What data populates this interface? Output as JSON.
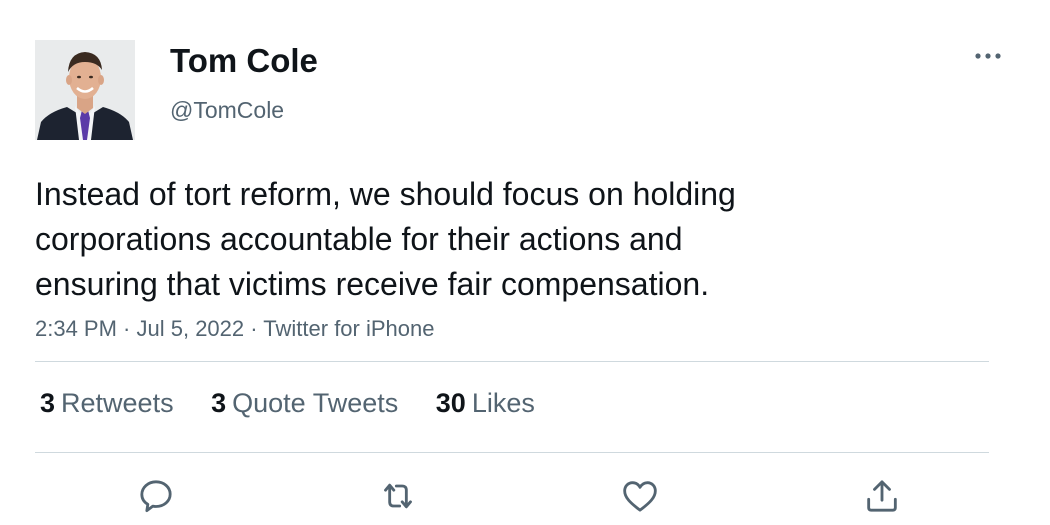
{
  "author": {
    "name": "Tom Cole",
    "handle": "@TomCole"
  },
  "more_icon": "more-horizontal-icon",
  "tweet": {
    "text": "Instead of tort reform, we should focus on holding\ncorporations accountable for their actions and\nensuring that victims receive fair compensation.",
    "time": "2:34 PM",
    "separator": " · ",
    "date": "Jul 5, 2022",
    "source": "Twitter for iPhone"
  },
  "stats": {
    "retweets": {
      "count": "3",
      "label": "Retweets"
    },
    "quote_tweets": {
      "count": "3",
      "label": "Quote Tweets"
    },
    "likes": {
      "count": "30",
      "label": "Likes"
    }
  },
  "actions": [
    {
      "icon": "reply-icon"
    },
    {
      "icon": "retweet-icon"
    },
    {
      "icon": "like-icon"
    },
    {
      "icon": "share-icon"
    }
  ],
  "colors": {
    "text_primary": "#0f1419",
    "text_secondary": "#536471",
    "divider": "#cfd9de"
  }
}
